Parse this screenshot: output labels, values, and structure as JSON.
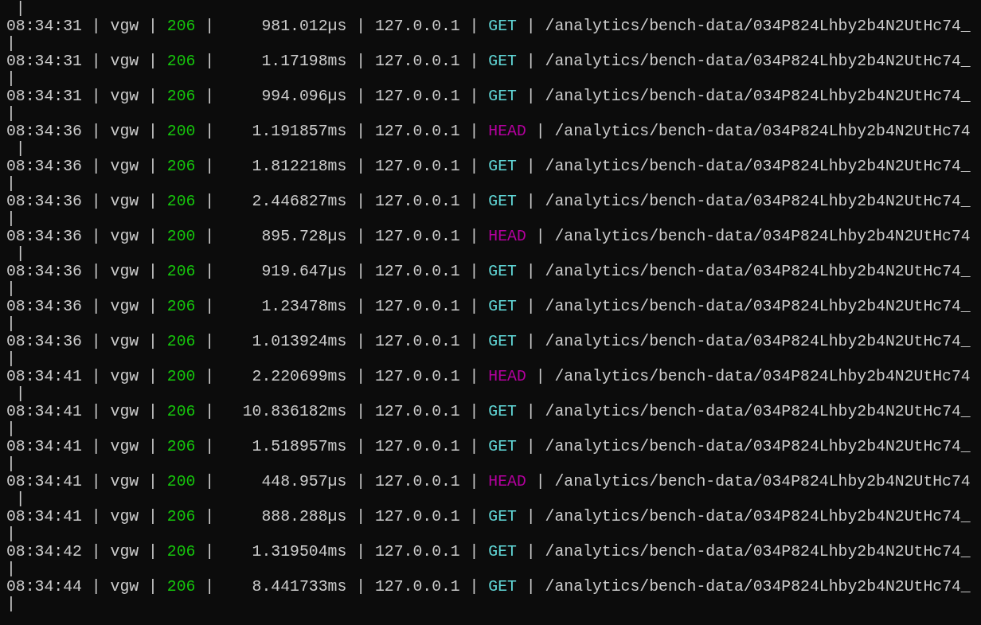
{
  "top_wrap": " |",
  "rows": [
    {
      "time": "08:34:31",
      "service": "vgw",
      "status": "206",
      "duration": "981.012µs",
      "ip": "127.0.0.1",
      "method": "GET",
      "color": "#61d6d6",
      "path": "/analytics/bench-data/034P824Lhby2b4N2UtHc74_",
      "separators": [
        "|",
        "|",
        "|",
        "|",
        "|",
        "|"
      ],
      "wrap": "|"
    },
    {
      "time": "08:34:31",
      "service": "vgw",
      "status": "206",
      "duration": "1.17198ms",
      "ip": "127.0.0.1",
      "method": "GET",
      "color": "#61d6d6",
      "path": "/analytics/bench-data/034P824Lhby2b4N2UtHc74_",
      "separators": [
        "|",
        "|",
        "|",
        "|",
        "|",
        "|"
      ],
      "wrap": "|"
    },
    {
      "time": "08:34:31",
      "service": "vgw",
      "status": "206",
      "duration": "994.096µs",
      "ip": "127.0.0.1",
      "method": "GET",
      "color": "#61d6d6",
      "path": "/analytics/bench-data/034P824Lhby2b4N2UtHc74_",
      "separators": [
        "|",
        "|",
        "|",
        "|",
        "|",
        "|"
      ],
      "wrap": "|"
    },
    {
      "time": "08:34:36",
      "service": "vgw",
      "status": "200",
      "duration": "1.191857ms",
      "ip": "127.0.0.1",
      "method": "HEAD",
      "color": "#b4009e",
      "path": "/analytics/bench-data/034P824Lhby2b4N2UtHc74",
      "separators": [
        "|",
        "|",
        "|",
        "|",
        "|",
        "|"
      ],
      "wrap": " |"
    },
    {
      "time": "08:34:36",
      "service": "vgw",
      "status": "206",
      "duration": "1.812218ms",
      "ip": "127.0.0.1",
      "method": "GET",
      "color": "#61d6d6",
      "path": "/analytics/bench-data/034P824Lhby2b4N2UtHc74_",
      "separators": [
        "|",
        "|",
        "|",
        "|",
        "|",
        "|"
      ],
      "wrap": "|"
    },
    {
      "time": "08:34:36",
      "service": "vgw",
      "status": "206",
      "duration": "2.446827ms",
      "ip": "127.0.0.1",
      "method": "GET",
      "color": "#61d6d6",
      "path": "/analytics/bench-data/034P824Lhby2b4N2UtHc74_",
      "separators": [
        "|",
        "|",
        "|",
        "|",
        "|",
        "|"
      ],
      "wrap": "|"
    },
    {
      "time": "08:34:36",
      "service": "vgw",
      "status": "200",
      "duration": "895.728µs",
      "ip": "127.0.0.1",
      "method": "HEAD",
      "color": "#b4009e",
      "path": "/analytics/bench-data/034P824Lhby2b4N2UtHc74",
      "separators": [
        "|",
        "|",
        "|",
        "|",
        "|",
        "|"
      ],
      "wrap": " |"
    },
    {
      "time": "08:34:36",
      "service": "vgw",
      "status": "206",
      "duration": "919.647µs",
      "ip": "127.0.0.1",
      "method": "GET",
      "color": "#61d6d6",
      "path": "/analytics/bench-data/034P824Lhby2b4N2UtHc74_",
      "separators": [
        "|",
        "|",
        "|",
        "|",
        "|",
        "|"
      ],
      "wrap": "|"
    },
    {
      "time": "08:34:36",
      "service": "vgw",
      "status": "206",
      "duration": "1.23478ms",
      "ip": "127.0.0.1",
      "method": "GET",
      "color": "#61d6d6",
      "path": "/analytics/bench-data/034P824Lhby2b4N2UtHc74_",
      "separators": [
        "|",
        "|",
        "|",
        "|",
        "|",
        "|"
      ],
      "wrap": "|"
    },
    {
      "time": "08:34:36",
      "service": "vgw",
      "status": "206",
      "duration": "1.013924ms",
      "ip": "127.0.0.1",
      "method": "GET",
      "color": "#61d6d6",
      "path": "/analytics/bench-data/034P824Lhby2b4N2UtHc74_",
      "separators": [
        "|",
        "|",
        "|",
        "|",
        "|",
        "|"
      ],
      "wrap": "|"
    },
    {
      "time": "08:34:41",
      "service": "vgw",
      "status": "200",
      "duration": "2.220699ms",
      "ip": "127.0.0.1",
      "method": "HEAD",
      "color": "#b4009e",
      "path": "/analytics/bench-data/034P824Lhby2b4N2UtHc74",
      "separators": [
        "|",
        "|",
        "|",
        "|",
        "|",
        "|"
      ],
      "wrap": " |"
    },
    {
      "time": "08:34:41",
      "service": "vgw",
      "status": "206",
      "duration": "10.836182ms",
      "ip": "127.0.0.1",
      "method": "GET",
      "color": "#61d6d6",
      "path": "/analytics/bench-data/034P824Lhby2b4N2UtHc74_",
      "separators": [
        "|",
        "|",
        "|",
        "|",
        "|",
        "|"
      ],
      "wrap": "|"
    },
    {
      "time": "08:34:41",
      "service": "vgw",
      "status": "206",
      "duration": "1.518957ms",
      "ip": "127.0.0.1",
      "method": "GET",
      "color": "#61d6d6",
      "path": "/analytics/bench-data/034P824Lhby2b4N2UtHc74_",
      "separators": [
        "|",
        "|",
        "|",
        "|",
        "|",
        "|"
      ],
      "wrap": "|"
    },
    {
      "time": "08:34:41",
      "service": "vgw",
      "status": "200",
      "duration": "448.957µs",
      "ip": "127.0.0.1",
      "method": "HEAD",
      "color": "#b4009e",
      "path": "/analytics/bench-data/034P824Lhby2b4N2UtHc74",
      "separators": [
        "|",
        "|",
        "|",
        "|",
        "|",
        "|"
      ],
      "wrap": " |"
    },
    {
      "time": "08:34:41",
      "service": "vgw",
      "status": "206",
      "duration": "888.288µs",
      "ip": "127.0.0.1",
      "method": "GET",
      "color": "#61d6d6",
      "path": "/analytics/bench-data/034P824Lhby2b4N2UtHc74_",
      "separators": [
        "|",
        "|",
        "|",
        "|",
        "|",
        "|"
      ],
      "wrap": "|"
    },
    {
      "time": "08:34:42",
      "service": "vgw",
      "status": "206",
      "duration": "1.319504ms",
      "ip": "127.0.0.1",
      "method": "GET",
      "color": "#61d6d6",
      "path": "/analytics/bench-data/034P824Lhby2b4N2UtHc74_",
      "separators": [
        "|",
        "|",
        "|",
        "|",
        "|",
        "|"
      ],
      "wrap": "|"
    },
    {
      "time": "08:34:44",
      "service": "vgw",
      "status": "206",
      "duration": "8.441733ms",
      "ip": "127.0.0.1",
      "method": "GET",
      "color": "#61d6d6",
      "path": "/analytics/bench-data/034P824Lhby2b4N2UtHc74_",
      "separators": [
        "|",
        "|",
        "|",
        "|",
        "|",
        "|"
      ],
      "wrap": "|"
    }
  ]
}
